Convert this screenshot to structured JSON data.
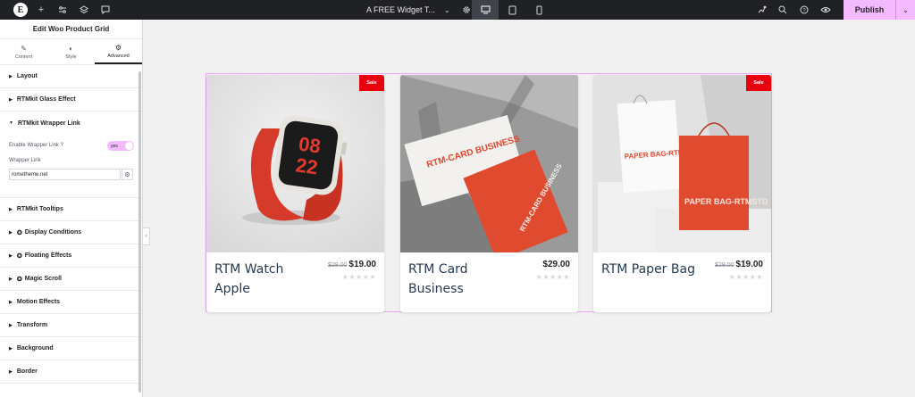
{
  "topbar": {
    "page_title": "A FREE Widget T...",
    "publish_label": "Publish"
  },
  "panel": {
    "header": "Edit Woo Product Grid",
    "tabs": [
      {
        "label": "Content",
        "icon": "pencil-icon"
      },
      {
        "label": "Style",
        "icon": "half-circle-icon"
      },
      {
        "label": "Advanced",
        "icon": "gear-icon"
      }
    ],
    "sections_before": [
      "Layout",
      "RTMkit Glass Effect"
    ],
    "open_section": {
      "title": "RTMkit Wrapper Link",
      "enable_label": "Enable Wrapper Link ?",
      "switch_value": "yes",
      "link_label": "Wrapper Link",
      "link_value": "rometheme.net"
    },
    "sections_after": [
      "RTMkit Tooltips",
      "Display Conditions",
      "Floating Effects",
      "Magic Scroll",
      "Motion Effects",
      "Transform",
      "Background",
      "Border"
    ]
  },
  "products": [
    {
      "title": "RTM Watch Apple",
      "old_price": "$29.00",
      "price": "$19.00",
      "sale": "Sale"
    },
    {
      "title": "RTM Card Business",
      "old_price": "",
      "price": "$29.00",
      "sale": ""
    },
    {
      "title": "RTM Paper Bag",
      "old_price": "$29.00",
      "price": "$19.00",
      "sale": "Sale"
    }
  ],
  "product_images": {
    "watch_time_top": "08",
    "watch_time_bottom": "22",
    "card_text": "RTM-CARD BUSINESS",
    "bag_text": "PAPER BAG-RTMSTD"
  },
  "colors": {
    "accent": "#f3bafd",
    "sale": "#e8000f",
    "title": "#243b53",
    "product_red": "#e04a2f"
  }
}
